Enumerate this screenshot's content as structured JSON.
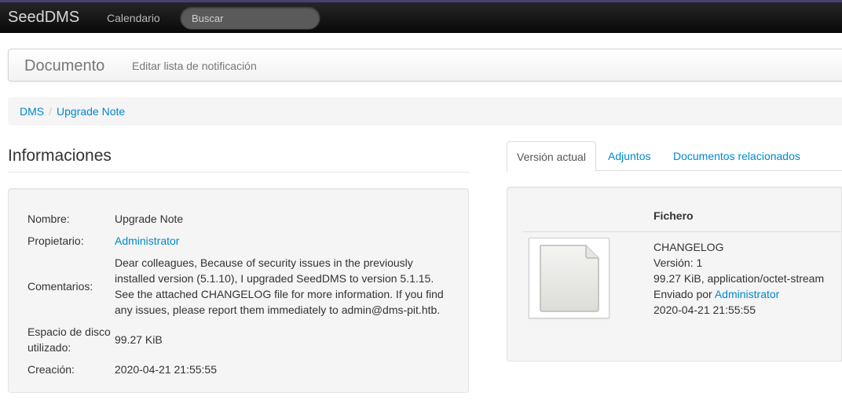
{
  "navbar": {
    "brand": "SeedDMS",
    "calendar": "Calendario",
    "search_placeholder": "Buscar"
  },
  "subheader": {
    "title": "Documento",
    "link": "Editar lista de notificación"
  },
  "breadcrumb": {
    "items": [
      "DMS",
      "Upgrade Note"
    ],
    "separator": "/"
  },
  "info": {
    "heading": "Informaciones",
    "rows": [
      {
        "label": "Nombre:",
        "value": "Upgrade Note"
      },
      {
        "label": "Propietario:",
        "value": "Administrator"
      },
      {
        "label": "Comentarios:",
        "value": "Dear colleagues, Because of security issues in the previously installed version (5.1.10), I upgraded SeedDMS to version 5.1.15. See the attached CHANGELOG file for more information. If you find any issues, please report them immediately to admin@dms-pit.htb."
      },
      {
        "label": "Espacio de disco utilizado:",
        "value": "99.27 KiB"
      },
      {
        "label": "Creación:",
        "value": "2020-04-21 21:55:55"
      }
    ]
  },
  "tabs": [
    "Versión actual",
    "Adjuntos",
    "Documentos relacionados"
  ],
  "file": {
    "column_header": "Fichero",
    "name": "CHANGELOG",
    "version": "Versión: 1",
    "size_type": "99.27 KiB, application/octet-stream",
    "sent_by_label": "Enviado por",
    "sent_by_user": "Administrator",
    "date": "2020-04-21 21:55:55"
  },
  "colors": {
    "link": "#0088cc",
    "navbar": "#1a1a1a",
    "navbar_accent": "#4a3f74"
  }
}
